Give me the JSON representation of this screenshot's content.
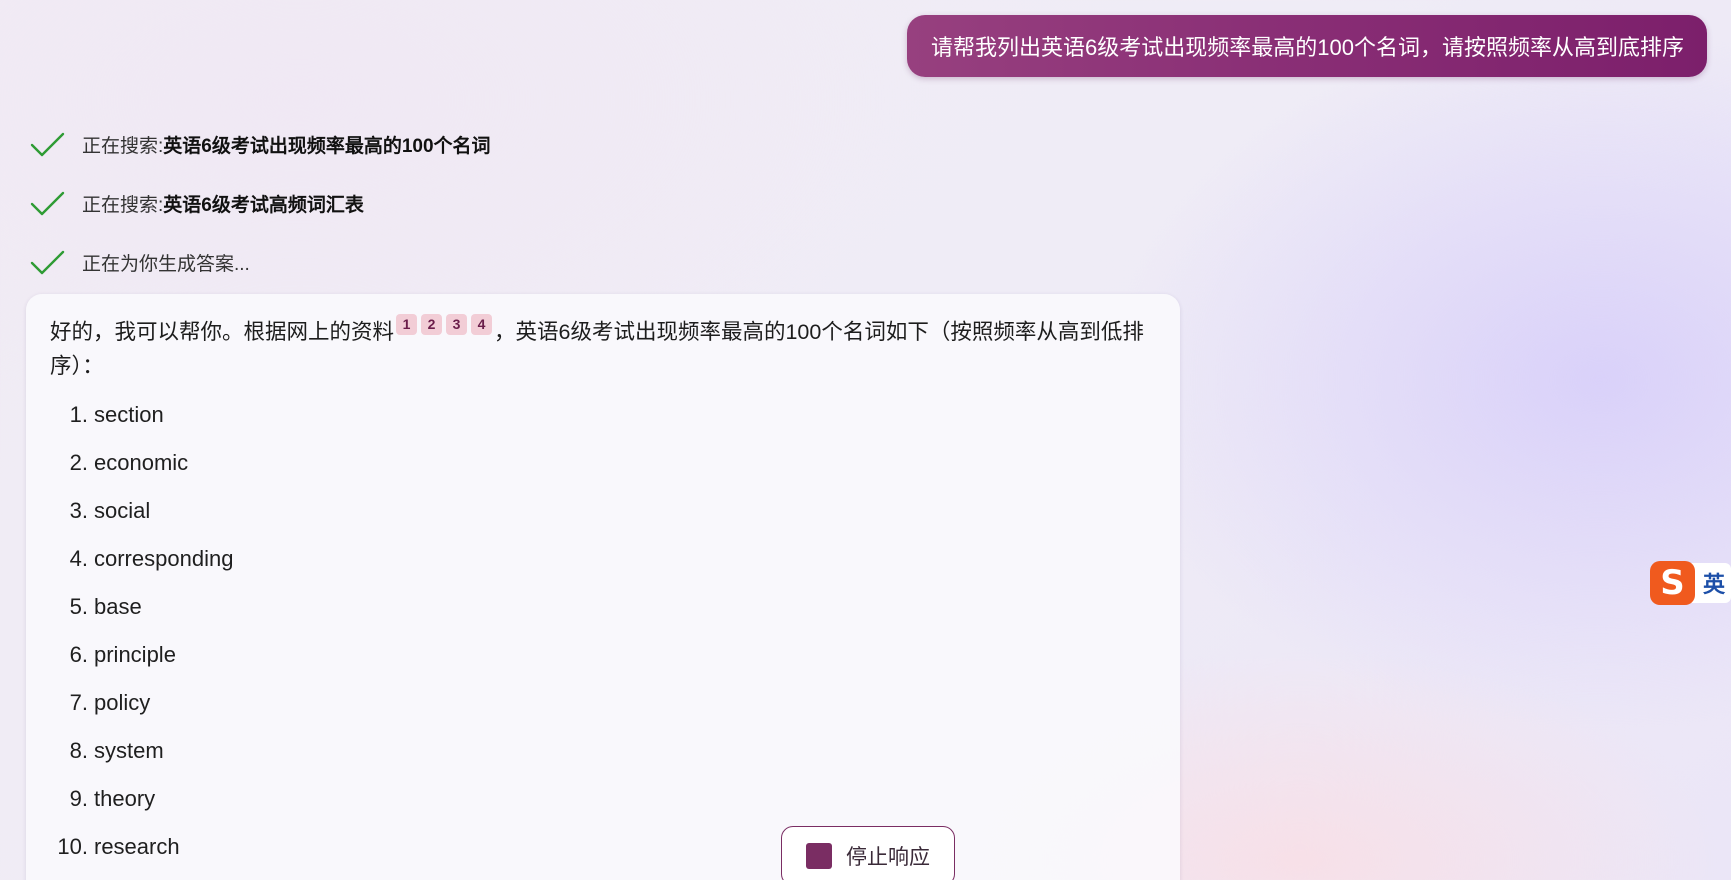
{
  "user_message": {
    "text": "请帮我列出英语6级考试出现频率最高的100个名词，请按照频率从高到底排序"
  },
  "steps": [
    {
      "prefix": "正在搜索: ",
      "query": "英语6级考试出现频率最高的100个名词",
      "icon": "check-icon"
    },
    {
      "prefix": "正在搜索: ",
      "query": "英语6级考试高频词汇表",
      "icon": "check-icon"
    },
    {
      "prefix": "正在为你生成答案...",
      "query": "",
      "icon": "check-icon"
    }
  ],
  "answer": {
    "intro_before": "好的，我可以帮你。根据网上的资料",
    "citations": [
      "1",
      "2",
      "3",
      "4"
    ],
    "intro_after": "，英语6级考试出现频率最高的100个名词如下（按照频率从高到低排序）：",
    "items": [
      {
        "num": "1.",
        "word": "section"
      },
      {
        "num": "2.",
        "word": "economic"
      },
      {
        "num": "3.",
        "word": "social"
      },
      {
        "num": "4.",
        "word": "corresponding"
      },
      {
        "num": "5.",
        "word": "base"
      },
      {
        "num": "6.",
        "word": "principle"
      },
      {
        "num": "7.",
        "word": "policy"
      },
      {
        "num": "8.",
        "word": "system"
      },
      {
        "num": "9.",
        "word": "theory"
      },
      {
        "num": "10.",
        "word": "research"
      }
    ]
  },
  "stop_button": {
    "label": "停止响应",
    "icon": "stop-square-icon"
  },
  "ime": {
    "logo": "S",
    "mode": "英"
  },
  "colors": {
    "bubble_start": "#97407f",
    "bubble_end": "#7c1f6b",
    "check_green": "#2e9b34",
    "citation_bg": "#f2cdd6",
    "stop_accent": "#7a2d63",
    "ime_orange": "#f05a1e"
  }
}
